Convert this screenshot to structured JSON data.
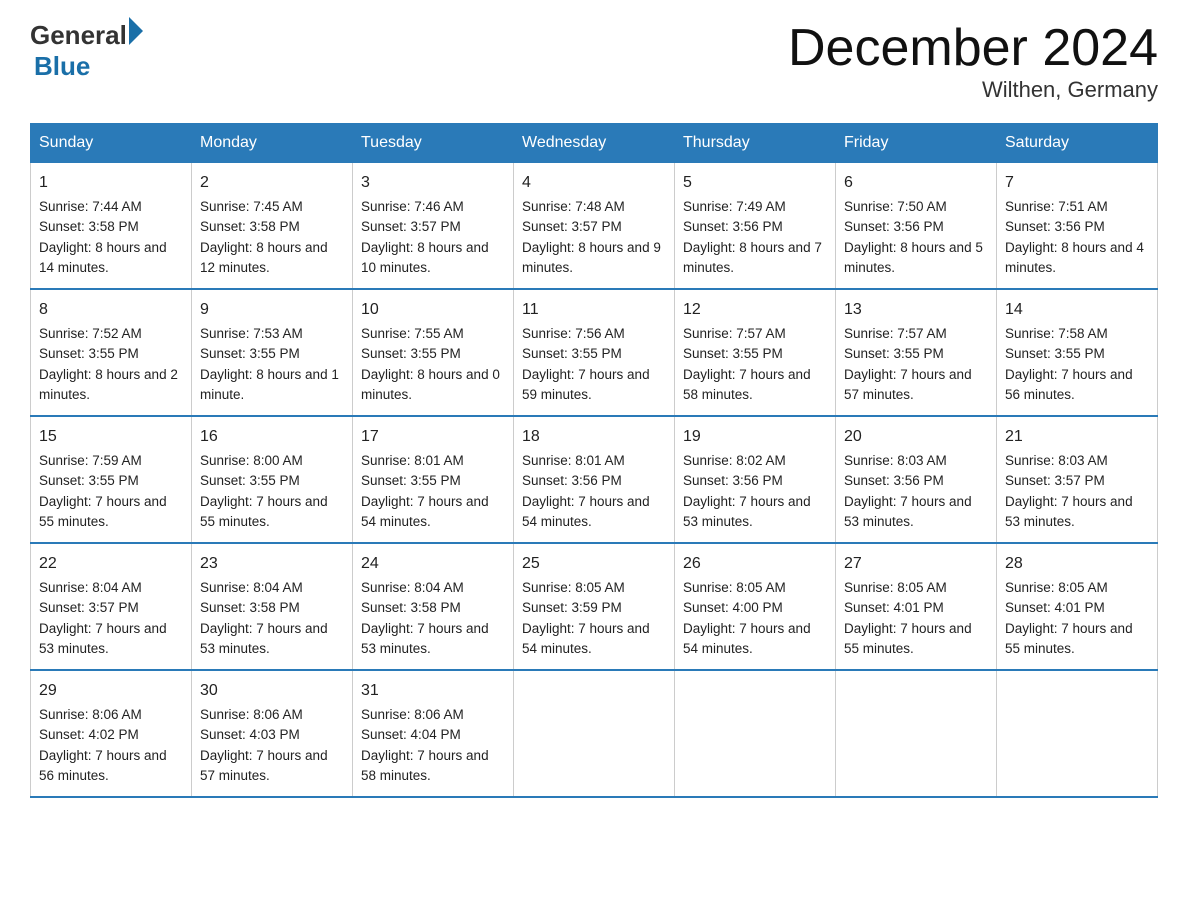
{
  "header": {
    "logo_general": "General",
    "logo_blue": "Blue",
    "month_title": "December 2024",
    "location": "Wilthen, Germany"
  },
  "weekdays": [
    "Sunday",
    "Monday",
    "Tuesday",
    "Wednesday",
    "Thursday",
    "Friday",
    "Saturday"
  ],
  "weeks": [
    [
      {
        "day": "1",
        "sunrise": "7:44 AM",
        "sunset": "3:58 PM",
        "daylight": "8 hours and 14 minutes."
      },
      {
        "day": "2",
        "sunrise": "7:45 AM",
        "sunset": "3:58 PM",
        "daylight": "8 hours and 12 minutes."
      },
      {
        "day": "3",
        "sunrise": "7:46 AM",
        "sunset": "3:57 PM",
        "daylight": "8 hours and 10 minutes."
      },
      {
        "day": "4",
        "sunrise": "7:48 AM",
        "sunset": "3:57 PM",
        "daylight": "8 hours and 9 minutes."
      },
      {
        "day": "5",
        "sunrise": "7:49 AM",
        "sunset": "3:56 PM",
        "daylight": "8 hours and 7 minutes."
      },
      {
        "day": "6",
        "sunrise": "7:50 AM",
        "sunset": "3:56 PM",
        "daylight": "8 hours and 5 minutes."
      },
      {
        "day": "7",
        "sunrise": "7:51 AM",
        "sunset": "3:56 PM",
        "daylight": "8 hours and 4 minutes."
      }
    ],
    [
      {
        "day": "8",
        "sunrise": "7:52 AM",
        "sunset": "3:55 PM",
        "daylight": "8 hours and 2 minutes."
      },
      {
        "day": "9",
        "sunrise": "7:53 AM",
        "sunset": "3:55 PM",
        "daylight": "8 hours and 1 minute."
      },
      {
        "day": "10",
        "sunrise": "7:55 AM",
        "sunset": "3:55 PM",
        "daylight": "8 hours and 0 minutes."
      },
      {
        "day": "11",
        "sunrise": "7:56 AM",
        "sunset": "3:55 PM",
        "daylight": "7 hours and 59 minutes."
      },
      {
        "day": "12",
        "sunrise": "7:57 AM",
        "sunset": "3:55 PM",
        "daylight": "7 hours and 58 minutes."
      },
      {
        "day": "13",
        "sunrise": "7:57 AM",
        "sunset": "3:55 PM",
        "daylight": "7 hours and 57 minutes."
      },
      {
        "day": "14",
        "sunrise": "7:58 AM",
        "sunset": "3:55 PM",
        "daylight": "7 hours and 56 minutes."
      }
    ],
    [
      {
        "day": "15",
        "sunrise": "7:59 AM",
        "sunset": "3:55 PM",
        "daylight": "7 hours and 55 minutes."
      },
      {
        "day": "16",
        "sunrise": "8:00 AM",
        "sunset": "3:55 PM",
        "daylight": "7 hours and 55 minutes."
      },
      {
        "day": "17",
        "sunrise": "8:01 AM",
        "sunset": "3:55 PM",
        "daylight": "7 hours and 54 minutes."
      },
      {
        "day": "18",
        "sunrise": "8:01 AM",
        "sunset": "3:56 PM",
        "daylight": "7 hours and 54 minutes."
      },
      {
        "day": "19",
        "sunrise": "8:02 AM",
        "sunset": "3:56 PM",
        "daylight": "7 hours and 53 minutes."
      },
      {
        "day": "20",
        "sunrise": "8:03 AM",
        "sunset": "3:56 PM",
        "daylight": "7 hours and 53 minutes."
      },
      {
        "day": "21",
        "sunrise": "8:03 AM",
        "sunset": "3:57 PM",
        "daylight": "7 hours and 53 minutes."
      }
    ],
    [
      {
        "day": "22",
        "sunrise": "8:04 AM",
        "sunset": "3:57 PM",
        "daylight": "7 hours and 53 minutes."
      },
      {
        "day": "23",
        "sunrise": "8:04 AM",
        "sunset": "3:58 PM",
        "daylight": "7 hours and 53 minutes."
      },
      {
        "day": "24",
        "sunrise": "8:04 AM",
        "sunset": "3:58 PM",
        "daylight": "7 hours and 53 minutes."
      },
      {
        "day": "25",
        "sunrise": "8:05 AM",
        "sunset": "3:59 PM",
        "daylight": "7 hours and 54 minutes."
      },
      {
        "day": "26",
        "sunrise": "8:05 AM",
        "sunset": "4:00 PM",
        "daylight": "7 hours and 54 minutes."
      },
      {
        "day": "27",
        "sunrise": "8:05 AM",
        "sunset": "4:01 PM",
        "daylight": "7 hours and 55 minutes."
      },
      {
        "day": "28",
        "sunrise": "8:05 AM",
        "sunset": "4:01 PM",
        "daylight": "7 hours and 55 minutes."
      }
    ],
    [
      {
        "day": "29",
        "sunrise": "8:06 AM",
        "sunset": "4:02 PM",
        "daylight": "7 hours and 56 minutes."
      },
      {
        "day": "30",
        "sunrise": "8:06 AM",
        "sunset": "4:03 PM",
        "daylight": "7 hours and 57 minutes."
      },
      {
        "day": "31",
        "sunrise": "8:06 AM",
        "sunset": "4:04 PM",
        "daylight": "7 hours and 58 minutes."
      },
      null,
      null,
      null,
      null
    ]
  ]
}
